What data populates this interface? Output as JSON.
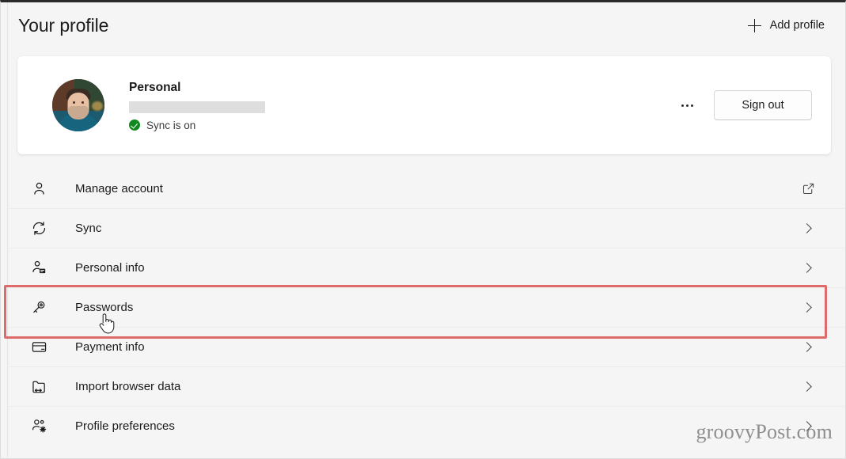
{
  "header": {
    "title": "Your profile",
    "add_profile_label": "Add profile",
    "add_profile_icon": "plus-icon"
  },
  "profile_card": {
    "avatar_icon": "avatar-photo",
    "name": "Personal",
    "email_redacted": true,
    "sync_status": "Sync is on",
    "sync_icon": "green-check-circle-icon",
    "more_options_icon": "ellipsis-icon",
    "sign_out_label": "Sign out"
  },
  "settings_list": {
    "items": [
      {
        "label": "Manage account",
        "icon": "person-icon",
        "trail_icon": "external-link-icon",
        "highlighted": false
      },
      {
        "label": "Sync",
        "icon": "sync-arrows-icon",
        "trail_icon": "chevron-right-icon",
        "highlighted": false
      },
      {
        "label": "Personal info",
        "icon": "person-card-icon",
        "trail_icon": "chevron-right-icon",
        "highlighted": false
      },
      {
        "label": "Passwords",
        "icon": "key-icon",
        "trail_icon": "chevron-right-icon",
        "highlighted": true
      },
      {
        "label": "Payment info",
        "icon": "credit-card-icon",
        "trail_icon": "chevron-right-icon",
        "highlighted": false
      },
      {
        "label": "Import browser data",
        "icon": "folder-import-icon",
        "trail_icon": "chevron-right-icon",
        "highlighted": false
      },
      {
        "label": "Profile preferences",
        "icon": "people-gear-icon",
        "trail_icon": "chevron-right-icon",
        "highlighted": false
      }
    ]
  },
  "annotation": {
    "highlight_color": "#de6a6a",
    "highlight_target": "Passwords",
    "cursor_icon": "hand-pointer-cursor"
  },
  "watermark": {
    "text": "groovyPost.com"
  },
  "colors": {
    "background": "#f5f5f5",
    "card_background": "#ffffff",
    "text": "#1b1b1b",
    "sync_green": "#108a1f",
    "annotation_red": "#de6a6a",
    "redaction_gray": "#dedede"
  }
}
